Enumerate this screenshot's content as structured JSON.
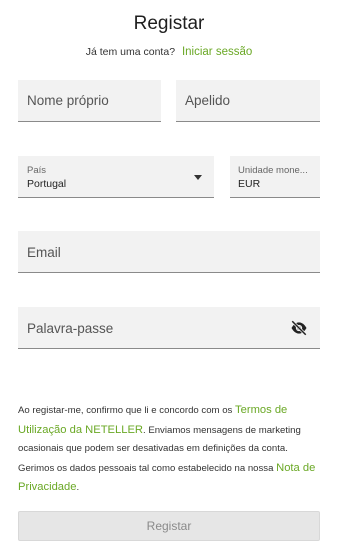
{
  "header": {
    "title": "Registar",
    "login_prompt": "Já tem uma conta?",
    "login_link": "Iniciar sessão"
  },
  "form": {
    "first_name": {
      "placeholder": "Nome próprio"
    },
    "last_name": {
      "placeholder": "Apelido"
    },
    "country": {
      "label": "País",
      "value": "Portugal"
    },
    "currency": {
      "label": "Unidade monetária",
      "label_display": "Unidade mone...",
      "value": "EUR"
    },
    "email": {
      "placeholder": "Email"
    },
    "password": {
      "placeholder": "Palavra-passe",
      "toggle_icon": "eye-off-icon"
    }
  },
  "terms": {
    "text_1": "Ao registar-me, confirmo que li e concordo com os",
    "link_1": "Termos de Utilização da NETELLER",
    "text_2": ". Enviamos mensagens de marketing ocasionais que podem ser desativadas em definições da conta. Gerimos os dados pessoais tal como estabelecido na nossa",
    "link_2": "Nota de Privacidade",
    "text_3": "."
  },
  "submit": {
    "label": "Registar"
  },
  "colors": {
    "accent": "#6aa825",
    "field_bg": "#f2f2f2",
    "button_disabled_bg": "#e6e6e6"
  }
}
